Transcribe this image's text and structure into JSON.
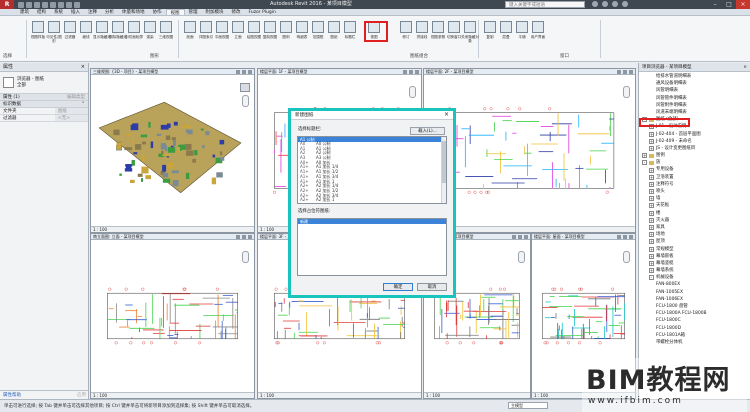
{
  "titlebar": {
    "title": "Autodesk Revit 2016 -  某项目模型",
    "search_placeholder": "键入关键字或短语",
    "app_letter": "R"
  },
  "tabs": [
    "建筑",
    "结构",
    "系统",
    "插入",
    "注释",
    "分析",
    "体量和场地",
    "协作",
    "视图",
    "管理",
    "附加模块",
    "修改",
    "Fuzor Plugin"
  ],
  "active_tab": "视图",
  "ribbon": {
    "panels": [
      {
        "label": "图形"
      },
      {
        "label": "图纸组合"
      },
      {
        "label": "窗口"
      }
    ],
    "buttons": [
      "视图样板",
      "可见性/图形",
      "过滤器",
      "细线",
      "显示隐藏线",
      "删除隐藏线",
      "剖切面轮廓",
      "渲染",
      "三维视图",
      "剖面",
      "详图索引",
      "平面视图",
      "立面",
      "绘图视图",
      "复制视图",
      "图例",
      "明细表",
      "范围框",
      "图纸",
      "标题栏",
      "视图",
      "修订",
      "拼接线",
      "视图参照",
      "切换窗口",
      "关闭隐藏对象",
      "复制",
      "层叠",
      "平铺",
      "用户界面"
    ],
    "select_label": "选择"
  },
  "properties": {
    "title": "属性",
    "type_name": "浏览器 - 图纸",
    "type_sub": "全部",
    "type_selector": "属性 (1)",
    "edit_type": "编辑类型",
    "group_label": "标识数据",
    "rows": [
      {
        "key": "文件夹",
        "value": "图纸"
      },
      {
        "key": "过滤器",
        "value": "<无>"
      }
    ],
    "help_link": "属性帮助",
    "apply": "应用"
  },
  "viewports": [
    {
      "title": "三维视图: {3D - 项目} - 某项目模型",
      "scale": "1 : 100"
    },
    {
      "title": "楼层平面: 1F - 某项目模型",
      "scale": "1 : 100"
    },
    {
      "title": "楼层平面: 2F - 某项目模型",
      "scale": "1 : 100"
    },
    {
      "title": "南立面图: 立面 - 某项目模型",
      "scale": "1 : 100"
    },
    {
      "title": "楼层平面: 3F - 某项目模型",
      "scale": "1 : 100"
    },
    {
      "title": "楼层平面: 4F - 某项目模型",
      "scale": "1 : 100"
    },
    {
      "title": "楼层平面: 屋面 - 某项目模型",
      "scale": "1 : 100"
    }
  ],
  "dialog": {
    "title": "新建图纸",
    "close": "×",
    "title_block_label": "选择标题栏:",
    "load_button": "载入(L)...",
    "selected": "A1 公制",
    "title_blocks": [
      {
        "code": "A0",
        "name": "A0 公制"
      },
      {
        "code": "A1",
        "name": "A1 公制"
      },
      {
        "code": "A2",
        "name": "A2 公制"
      },
      {
        "code": "A3",
        "name": "A3 公制"
      },
      {
        "code": "A0+",
        "name": "A0 加长"
      },
      {
        "code": "A1+",
        "name": "A1 加长 1/4"
      },
      {
        "code": "A1+",
        "name": "A1 加长 1/2"
      },
      {
        "code": "A1+",
        "name": "A1 加长 3/4"
      },
      {
        "code": "A1+",
        "name": "A1 加长 1"
      },
      {
        "code": "A2+",
        "name": "A2 加长 1/4"
      },
      {
        "code": "A2+",
        "name": "A2 加长 1/2"
      },
      {
        "code": "A2+",
        "name": "A2 加长 3/4"
      },
      {
        "code": "A2+",
        "name": "A2 加长 1"
      }
    ],
    "placeholder_label": "选择占位符图纸:",
    "placeholder_selected": "新建",
    "ok": "确定",
    "cancel": "取消"
  },
  "browser": {
    "title": "项目浏览器 - 某项目模型",
    "items": [
      {
        "indent": 2,
        "exp": "",
        "text": "给排水管道明细表"
      },
      {
        "indent": 2,
        "exp": "",
        "text": "通风设备明细表"
      },
      {
        "indent": 2,
        "exp": "",
        "text": "风管明细表"
      },
      {
        "indent": 2,
        "exp": "",
        "text": "风管管件明细表"
      },
      {
        "indent": 2,
        "exp": "",
        "text": "风管附件明细表"
      },
      {
        "indent": 2,
        "exp": "",
        "text": "风道末端明细表"
      },
      {
        "indent": 0,
        "exp": "-",
        "text": "图纸 (全部)",
        "hl": true
      },
      {
        "indent": 1,
        "exp": "+",
        "text": "J-01 - 设计说明"
      },
      {
        "indent": 1,
        "exp": "+",
        "text": "J-02-404 - 首层平面图"
      },
      {
        "indent": 1,
        "exp": "+",
        "text": "J-02-409 - 未命名"
      },
      {
        "indent": 1,
        "exp": "+",
        "text": "JS - 设计变更图纸目"
      },
      {
        "indent": 0,
        "exp": "+",
        "text": "图例"
      },
      {
        "indent": 0,
        "exp": "-",
        "text": "族"
      },
      {
        "indent": 1,
        "exp": "+",
        "text": "专用设备"
      },
      {
        "indent": 1,
        "exp": "+",
        "text": "卫浴装置"
      },
      {
        "indent": 1,
        "exp": "+",
        "text": "注释符号"
      },
      {
        "indent": 1,
        "exp": "+",
        "text": "喷头"
      },
      {
        "indent": 1,
        "exp": "+",
        "text": "墙"
      },
      {
        "indent": 1,
        "exp": "+",
        "text": "天花板"
      },
      {
        "indent": 1,
        "exp": "+",
        "text": "楼"
      },
      {
        "indent": 1,
        "exp": "+",
        "text": "灭火器"
      },
      {
        "indent": 1,
        "exp": "+",
        "text": "家具"
      },
      {
        "indent": 1,
        "exp": "+",
        "text": "场地"
      },
      {
        "indent": 1,
        "exp": "+",
        "text": "屋顶"
      },
      {
        "indent": 1,
        "exp": "+",
        "text": "常规模型"
      },
      {
        "indent": 1,
        "exp": "+",
        "text": "幕墙嵌板"
      },
      {
        "indent": 1,
        "exp": "+",
        "text": "幕墙竖梃"
      },
      {
        "indent": 1,
        "exp": "+",
        "text": "幕墙系统"
      },
      {
        "indent": 1,
        "exp": "-",
        "text": "机械设备"
      },
      {
        "indent": 2,
        "exp": "",
        "text": "FAN-800EX"
      },
      {
        "indent": 2,
        "exp": "",
        "text": "FAN-1005EX"
      },
      {
        "indent": 2,
        "exp": "",
        "text": "FAN-1006EX"
      },
      {
        "indent": 2,
        "exp": "",
        "text": "FCU-1800 盘管"
      },
      {
        "indent": 2,
        "exp": "",
        "text": "FCU-1800A FCU-1800B"
      },
      {
        "indent": 2,
        "exp": "",
        "text": "FCU-1800C"
      },
      {
        "indent": 2,
        "exp": "",
        "text": "FCU-1800D"
      },
      {
        "indent": 2,
        "exp": "",
        "text": "FCU-1801A箱"
      },
      {
        "indent": 2,
        "exp": "",
        "text": "带螺栓分体机"
      }
    ]
  },
  "statusbar": {
    "text": "单击可进行选择; 按 Tab 键并单击可选择其他项目; 按 Ctrl 键并单击可将新项目添加到选择集; 按 Shift 键并单击可取消选择。",
    "model": "主模型"
  },
  "watermark": {
    "brand": "BIM教程网",
    "url": "www.ifbim.com"
  }
}
